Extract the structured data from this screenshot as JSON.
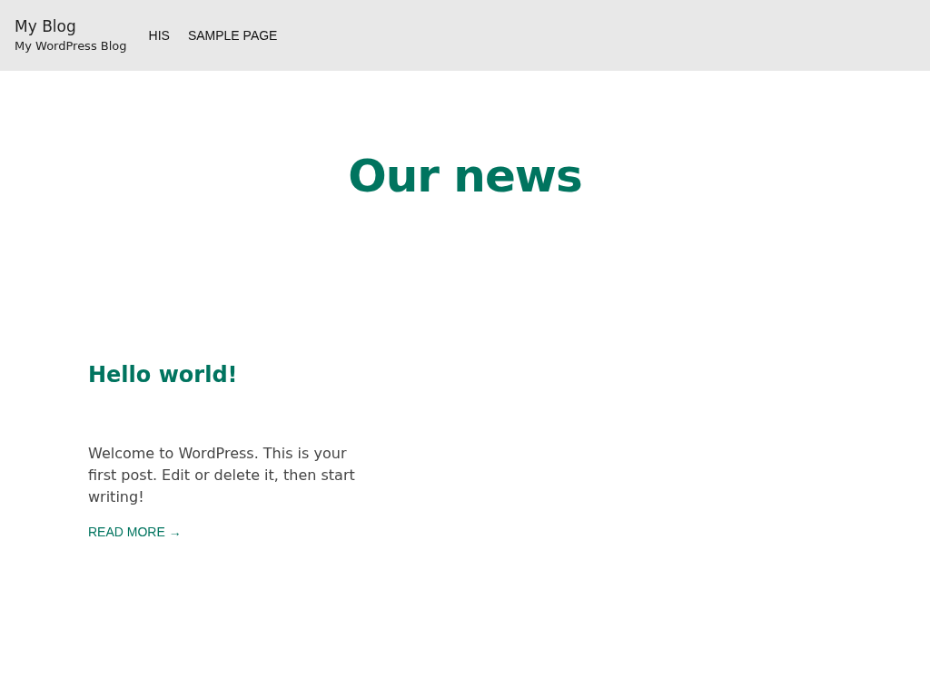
{
  "site": {
    "title": "My Blog",
    "tagline": "My WordPress Blog"
  },
  "nav": [
    {
      "label": "HIS"
    },
    {
      "label": "SAMPLE PAGE"
    }
  ],
  "heading": "Our news",
  "posts": [
    {
      "title": "Hello world!",
      "excerpt": "Welcome to WordPress. This is your first post. Edit or delete it, then start writing!",
      "read_more": "READ MORE →"
    }
  ]
}
